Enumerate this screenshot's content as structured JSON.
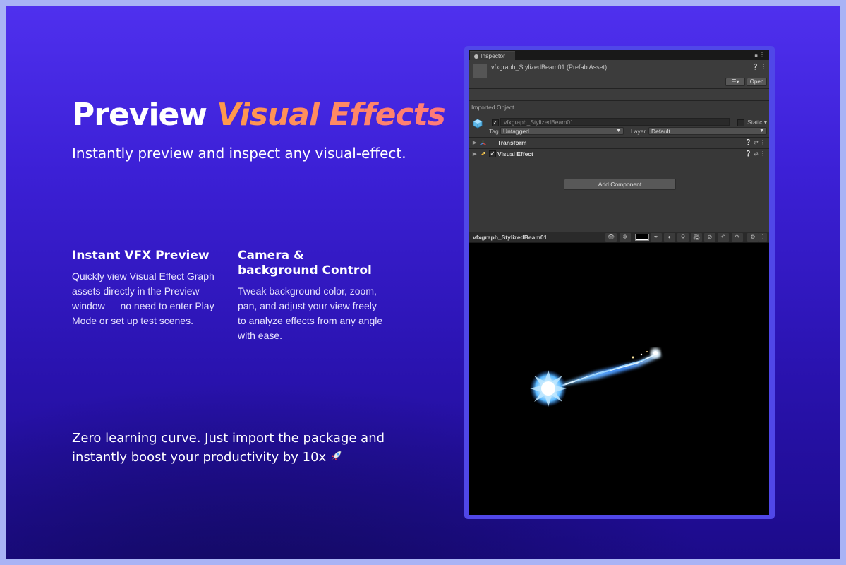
{
  "marketing": {
    "headline_plain": "Preview",
    "headline_accent": "Visual Effects",
    "subtitle": "Instantly preview and inspect any visual-effect.",
    "features": [
      {
        "title": "Instant VFX Preview",
        "body": "Quickly view Visual Effect Graph assets directly in the Preview window — no need to enter Play Mode or set up test scenes."
      },
      {
        "title": "Camera & background Control",
        "body": "Tweak background color, zoom, pan, and adjust your view freely to analyze effects from any angle with ease."
      }
    ],
    "tagline": "Zero learning curve. Just import the package and instantly boost your productivity by 10x"
  },
  "inspector": {
    "tab_label": "Inspector",
    "asset_title": "vfxgraph_StylizedBeam01 (Prefab Asset)",
    "open_button": "Open",
    "section_label": "Imported Object",
    "object_name": "vfxgraph_StylizedBeam01",
    "static_label": "Static",
    "tag_label": "Tag",
    "tag_value": "Untagged",
    "layer_label": "Layer",
    "layer_value": "Default",
    "components": [
      {
        "name": "Transform",
        "icon": "transform-icon"
      },
      {
        "name": "Visual Effect",
        "icon": "visual-effect-icon"
      }
    ],
    "add_component": "Add Component",
    "preview_title": "vfxgraph_StylizedBeam01",
    "preview_background": "#000000"
  },
  "colors": {
    "accent_gradient_start": "#ff9a4a",
    "accent_gradient_end": "#ff7a7a",
    "panel_border": "#5047e8",
    "effect_glow": "#7fd4ff"
  }
}
